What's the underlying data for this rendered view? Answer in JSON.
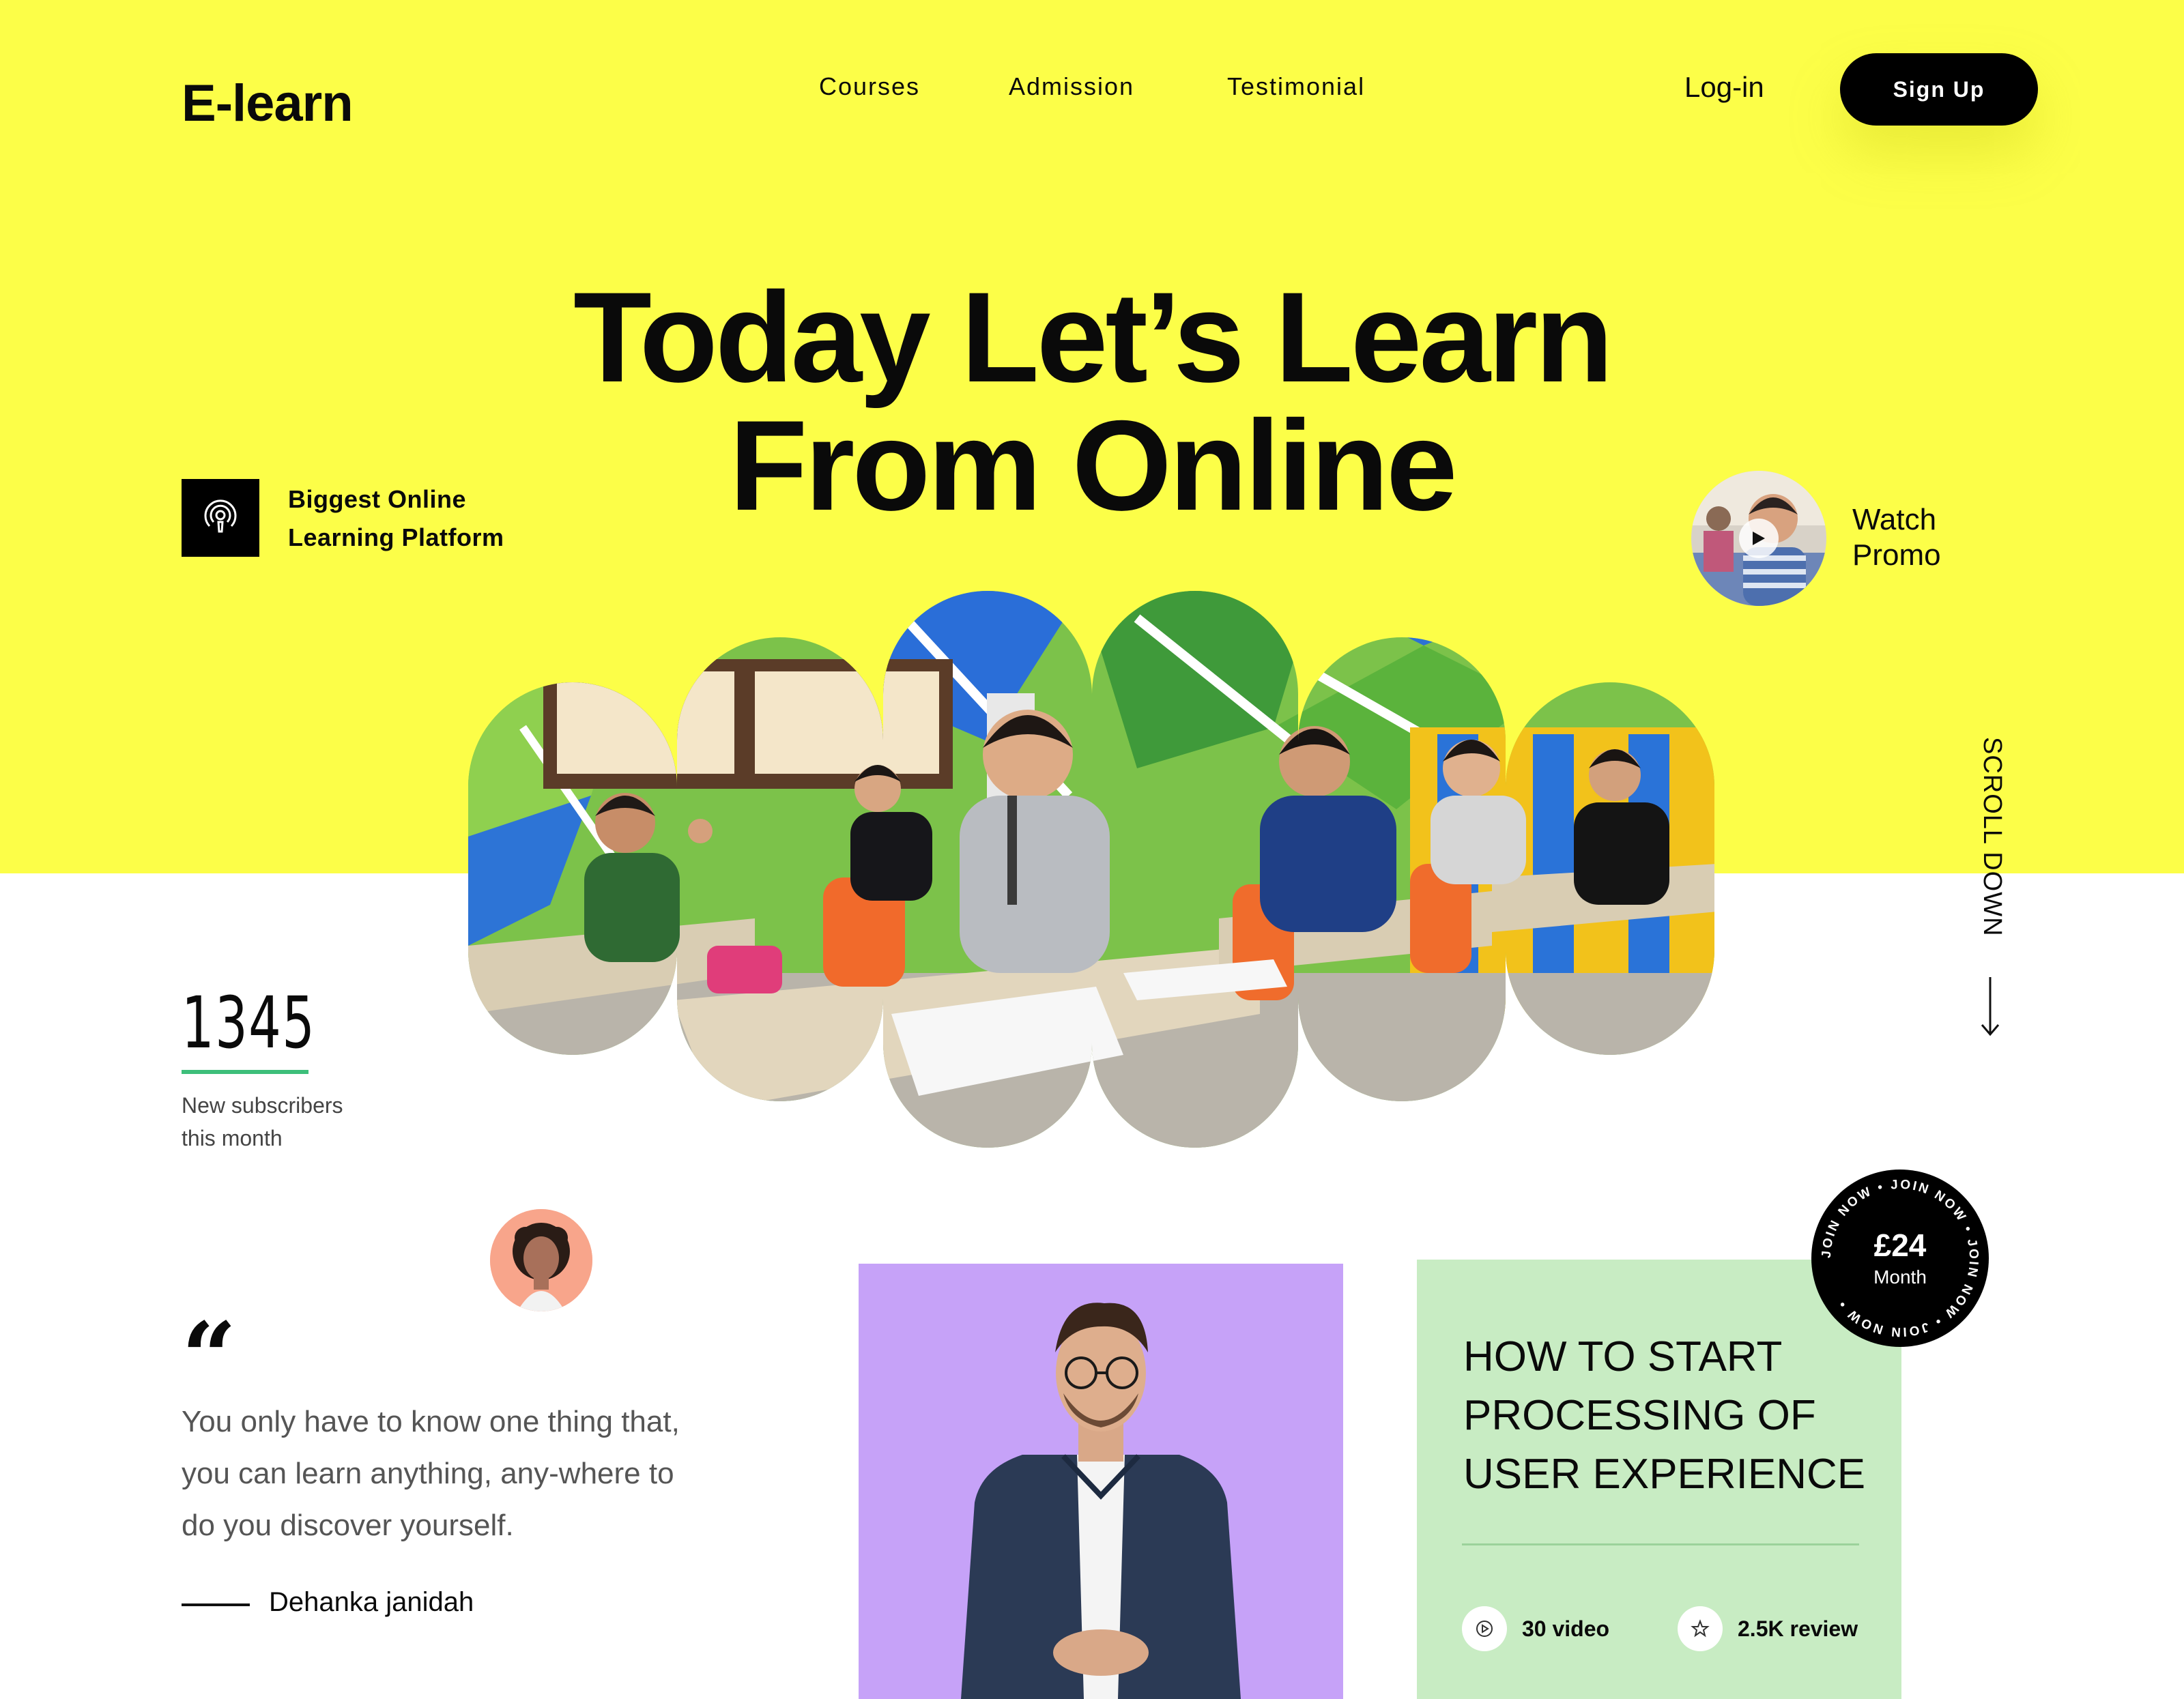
{
  "header": {
    "logo": "E-learn",
    "nav": [
      "Courses",
      "Admission",
      "Testimonial"
    ],
    "login": "Log-in",
    "signup": "Sign Up"
  },
  "hero": {
    "headline_line1": "Today Let’s Learn",
    "headline_line2": "From Online",
    "badge_line1": "Biggest Online",
    "badge_line2": "Learning Platform",
    "promo_line1": "Watch",
    "promo_line2": "Promo",
    "scroll": "SCROLL DOWN"
  },
  "stats": {
    "value": "1345",
    "label_line1": "New subscribers",
    "label_line2": "this month"
  },
  "testimonial": {
    "quote_mark": "“",
    "quote": "You only have to know one thing that, you can learn anything, any-where to do you discover yourself.",
    "author": "Dehanka janidah"
  },
  "course": {
    "title_line1": "HOW TO START",
    "title_line2": "PROCESSING OF",
    "title_line3": "USER EXPERIENCE",
    "videos": "30 video",
    "reviews": "2.5K review",
    "price": "£24",
    "period": "Month",
    "ring_text": "JOIN NOW • JOIN NOW • JOIN NOW • JOIN NOW •"
  },
  "colors": {
    "hero_bg": "#fcfe48",
    "accent_green": "#3dbf7a",
    "instructor_bg": "#c6a2f8",
    "course_bg": "#c8ecc3",
    "avatar_bg": "#f8a58b"
  },
  "icons": [
    "podcast-icon",
    "play-icon",
    "arrow-down-icon",
    "play-circle-icon",
    "star-icon"
  ]
}
